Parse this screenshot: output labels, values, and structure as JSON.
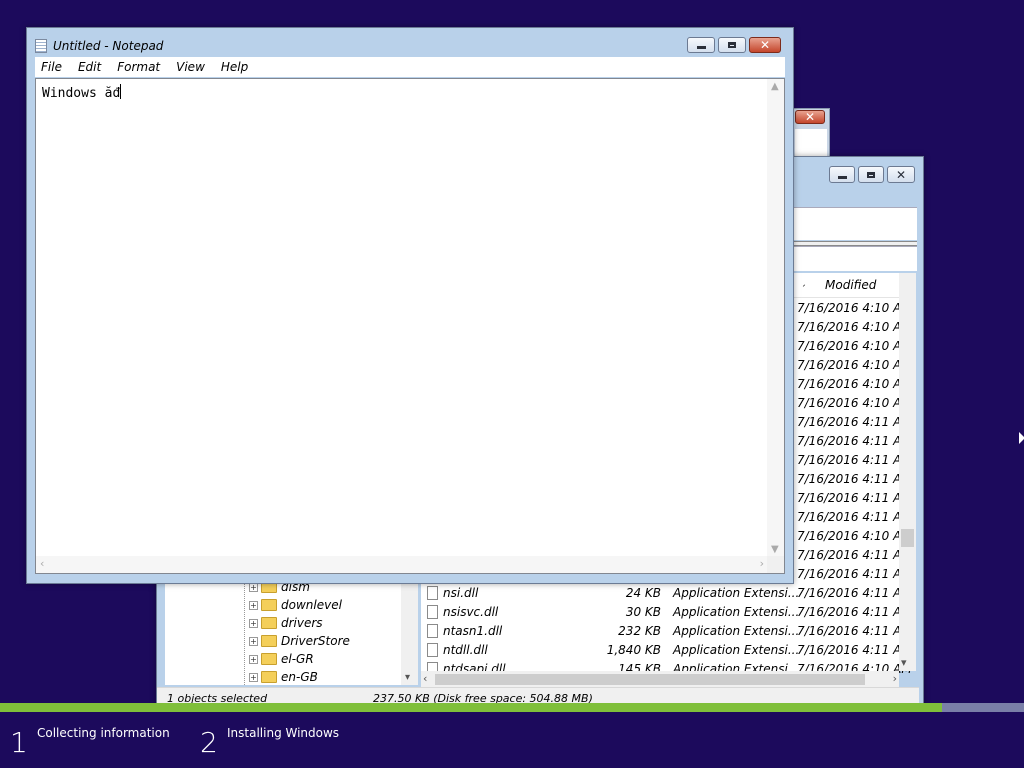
{
  "setup": {
    "progress_fraction": 0.92,
    "steps": [
      {
        "number": "1",
        "label": "Collecting information"
      },
      {
        "number": "2",
        "label": "Installing Windows"
      }
    ]
  },
  "notepad": {
    "title": "Untitled - Notepad",
    "menu": [
      "File",
      "Edit",
      "Format",
      "View",
      "Help"
    ],
    "text": "Windows ăđ"
  },
  "explorer": {
    "column_modified": "Modified",
    "tree": [
      "dism",
      "downlevel",
      "drivers",
      "DriverStore",
      "el-GR",
      "en-GB"
    ],
    "modified_only": [
      "7/16/2016 4:10 AM",
      "7/16/2016 4:10 AM",
      "7/16/2016 4:10 AM",
      "7/16/2016 4:10 AM",
      "7/16/2016 4:10 AM",
      "7/16/2016 4:10 AM",
      "7/16/2016 4:11 AM",
      "7/16/2016 4:11 AM",
      "7/16/2016 4:11 AM",
      "7/16/2016 4:11 AM",
      "7/16/2016 4:11 AM",
      "7/16/2016 4:11 AM",
      "7/16/2016 4:10 AM",
      "7/16/2016 4:11 AM",
      "7/16/2016 4:11 AM"
    ],
    "files": [
      {
        "name": "nsi.dll",
        "size": "24 KB",
        "type": "Application Extensi...",
        "modified": "7/16/2016 4:11 AM"
      },
      {
        "name": "nsisvc.dll",
        "size": "30 KB",
        "type": "Application Extensi...",
        "modified": "7/16/2016 4:11 AM"
      },
      {
        "name": "ntasn1.dll",
        "size": "232 KB",
        "type": "Application Extensi...",
        "modified": "7/16/2016 4:11 AM"
      },
      {
        "name": "ntdll.dll",
        "size": "1,840 KB",
        "type": "Application Extensi...",
        "modified": "7/16/2016 4:11 AM"
      },
      {
        "name": "ntdsapi.dll",
        "size": "145 KB",
        "type": "Application Extensi...",
        "modified": "7/16/2016 4:10 AM"
      }
    ],
    "status_selected": "1 objects selected",
    "status_size": "237.50 KB (Disk free space: 504.88 MB)"
  }
}
